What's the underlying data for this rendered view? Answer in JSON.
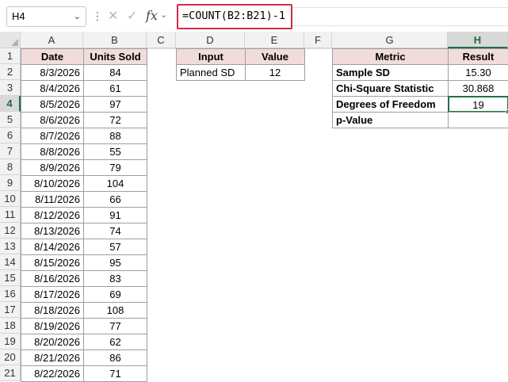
{
  "formula_bar": {
    "name_box": "H4",
    "formula": "=COUNT(B2:B21)-1",
    "icons": [
      "chevron-down-icon",
      "more-dots-icon",
      "cancel-icon",
      "enter-check-icon",
      "insert-function-icon"
    ]
  },
  "columns": [
    "A",
    "B",
    "C",
    "D",
    "E",
    "F",
    "G",
    "H"
  ],
  "rows": [
    "1",
    "2",
    "3",
    "4",
    "5",
    "6",
    "7",
    "8",
    "9",
    "10",
    "11",
    "12",
    "13",
    "14",
    "15",
    "16",
    "17",
    "18",
    "19",
    "20",
    "21"
  ],
  "sales_table": {
    "headers": [
      "Date",
      "Units Sold"
    ],
    "rows": [
      [
        "8/3/2026",
        "84"
      ],
      [
        "8/4/2026",
        "61"
      ],
      [
        "8/5/2026",
        "97"
      ],
      [
        "8/6/2026",
        "72"
      ],
      [
        "8/7/2026",
        "88"
      ],
      [
        "8/8/2026",
        "55"
      ],
      [
        "8/9/2026",
        "79"
      ],
      [
        "8/10/2026",
        "104"
      ],
      [
        "8/11/2026",
        "66"
      ],
      [
        "8/12/2026",
        "91"
      ],
      [
        "8/13/2026",
        "74"
      ],
      [
        "8/14/2026",
        "57"
      ],
      [
        "8/15/2026",
        "95"
      ],
      [
        "8/16/2026",
        "83"
      ],
      [
        "8/17/2026",
        "69"
      ],
      [
        "8/18/2026",
        "108"
      ],
      [
        "8/19/2026",
        "77"
      ],
      [
        "8/20/2026",
        "62"
      ],
      [
        "8/21/2026",
        "86"
      ],
      [
        "8/22/2026",
        "71"
      ]
    ]
  },
  "input_table": {
    "headers": [
      "Input",
      "Value"
    ],
    "rows": [
      [
        "Planned SD",
        "12"
      ]
    ]
  },
  "metric_table": {
    "headers": [
      "Metric",
      "Result"
    ],
    "rows": [
      [
        "Sample SD",
        "15.30"
      ],
      [
        "Chi-Square Statistic",
        "30.868"
      ],
      [
        "Degrees of Freedom",
        "19"
      ],
      [
        "p-Value",
        ""
      ]
    ]
  },
  "colors": {
    "header_fill": "#f2dcdb",
    "selection_green": "#217346",
    "formula_highlight": "#d2284b"
  }
}
